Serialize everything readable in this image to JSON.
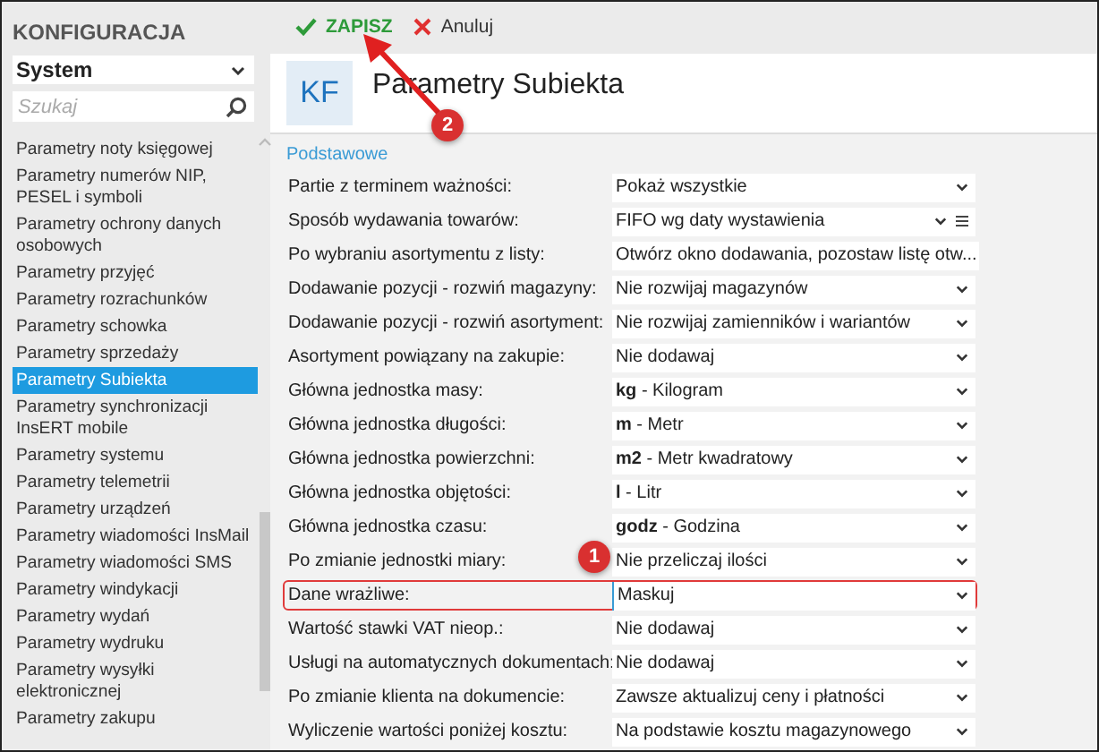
{
  "sidebar": {
    "title": "KONFIGURACJA",
    "module": "System",
    "search": {
      "placeholder": "Szukaj"
    },
    "items": [
      {
        "label": "Parametry noty księgowej",
        "selected": false
      },
      {
        "label": "Parametry numerów NIP, PESEL i symboli",
        "selected": false
      },
      {
        "label": "Parametry ochrony danych osobowych",
        "selected": false
      },
      {
        "label": "Parametry przyjęć",
        "selected": false
      },
      {
        "label": "Parametry rozrachunków",
        "selected": false
      },
      {
        "label": "Parametry schowka",
        "selected": false
      },
      {
        "label": "Parametry sprzedaży",
        "selected": false
      },
      {
        "label": "Parametry Subiekta",
        "selected": true
      },
      {
        "label": "Parametry synchronizacji InsERT mobile",
        "selected": false
      },
      {
        "label": "Parametry systemu",
        "selected": false
      },
      {
        "label": "Parametry telemetrii",
        "selected": false
      },
      {
        "label": "Parametry urządzeń",
        "selected": false
      },
      {
        "label": "Parametry wiadomości InsMail",
        "selected": false
      },
      {
        "label": "Parametry wiadomości SMS",
        "selected": false
      },
      {
        "label": "Parametry windykacji",
        "selected": false
      },
      {
        "label": "Parametry wydań",
        "selected": false
      },
      {
        "label": "Parametry wydruku",
        "selected": false
      },
      {
        "label": "Parametry wysyłki elektronicznej",
        "selected": false
      },
      {
        "label": "Parametry zakupu",
        "selected": false
      }
    ]
  },
  "toolbar": {
    "save": "ZAPISZ",
    "cancel": "Anuluj"
  },
  "header": {
    "badge": "KF",
    "title": "Parametry Subiekta"
  },
  "section": "Podstawowe",
  "rows": [
    {
      "label": "Partie z terminem ważności:",
      "value": "Pokaż wszystkie",
      "kind": "select",
      "highlighted": false
    },
    {
      "label": "Sposób wydawania towarów:",
      "value": "FIFO wg daty wystawienia",
      "kind": "select-list",
      "highlighted": false
    },
    {
      "label": "Po wybraniu asortymentu z listy:",
      "value": "Otwórz okno dodawania, pozostaw listę otw...",
      "kind": "select",
      "highlighted": false
    },
    {
      "label": "Dodawanie pozycji - rozwiń magazyny:",
      "value": "Nie rozwijaj magazynów",
      "kind": "select",
      "highlighted": false
    },
    {
      "label": "Dodawanie pozycji - rozwiń asortyment:",
      "value": "Nie rozwijaj zamienników i wariantów",
      "kind": "select",
      "highlighted": false
    },
    {
      "label": "Asortyment powiązany na zakupie:",
      "value": "Nie dodawaj",
      "kind": "select",
      "highlighted": false
    },
    {
      "label": "Główna jednostka masy:",
      "value": "**kg** - Kilogram",
      "kind": "select",
      "highlighted": false
    },
    {
      "label": "Główna jednostka długości:",
      "value": "**m** - Metr",
      "kind": "select",
      "highlighted": false
    },
    {
      "label": "Główna jednostka powierzchni:",
      "value": "**m2** - Metr kwadratowy",
      "kind": "select",
      "highlighted": false
    },
    {
      "label": "Główna jednostka objętości:",
      "value": "**l** - Litr",
      "kind": "select",
      "highlighted": false
    },
    {
      "label": "Główna jednostka czasu:",
      "value": "**godz** - Godzina",
      "kind": "select",
      "highlighted": false
    },
    {
      "label": "Po zmianie jednostki miary:",
      "value": "Nie przeliczaj ilości",
      "kind": "select",
      "highlighted": false
    },
    {
      "label": "Dane wrażliwe:",
      "value": "Maskuj",
      "kind": "select",
      "highlighted": true
    },
    {
      "label": "Wartość stawki VAT nieop.:",
      "value": "Nie dodawaj",
      "kind": "select",
      "highlighted": false
    },
    {
      "label": "Usługi na automatycznych dokumentach:",
      "value": "Nie dodawaj",
      "kind": "select",
      "highlighted": false
    },
    {
      "label": "Po zmianie klienta na dokumencie:",
      "value": "Zawsze aktualizuj ceny i płatności",
      "kind": "select",
      "highlighted": false
    },
    {
      "label": "Wyliczenie wartości poniżej kosztu:",
      "value": "Na podstawie kosztu magazynowego",
      "kind": "select",
      "highlighted": false
    }
  ],
  "annotations": [
    "1",
    "2"
  ]
}
